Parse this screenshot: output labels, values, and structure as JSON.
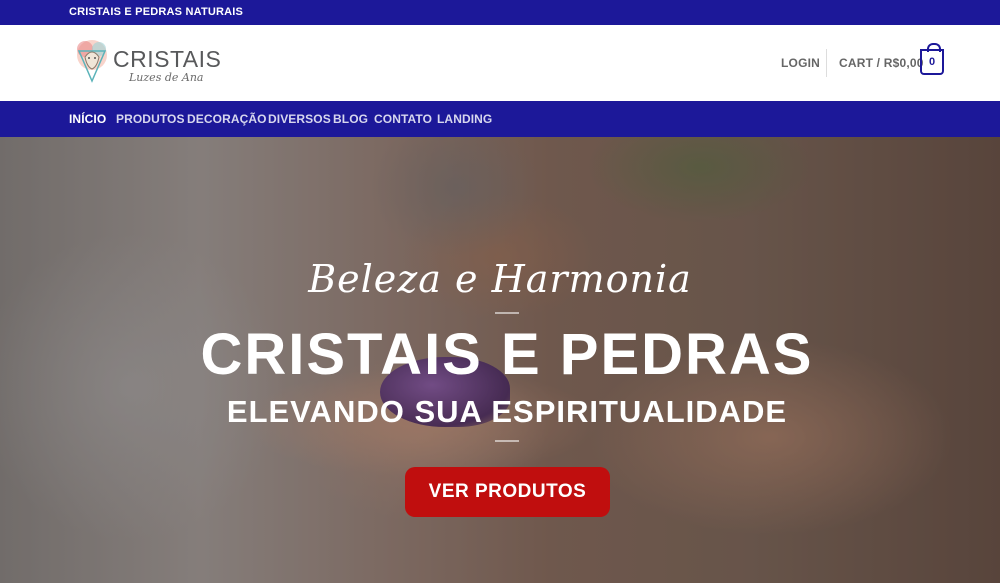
{
  "topbar": {
    "text": "CRISTAIS E PEDRAS NATURAIS"
  },
  "header": {
    "logo": {
      "word": "CRISTAIS",
      "script": "Luzes de Ana"
    },
    "login_label": "LOGIN",
    "cart_label": "CART / R$0,00",
    "cart_count": "0"
  },
  "nav": {
    "items": [
      {
        "label": "INÍCIO",
        "active": true
      },
      {
        "label": "PRODUTOS"
      },
      {
        "label": "DECORAÇÃO"
      },
      {
        "label": "DIVERSOS"
      },
      {
        "label": "BLOG"
      },
      {
        "label": "CONTATO"
      },
      {
        "label": "LANDING"
      }
    ]
  },
  "hero": {
    "script": "Beleza e Harmonia",
    "title": "CRISTAIS E PEDRAS",
    "subtitle": "ELEVANDO SUA ESPIRITUALIDADE",
    "button_label": "VER PRODUTOS"
  },
  "colors": {
    "brand_blue": "#1c1899",
    "cta_red": "#c00e0e"
  },
  "icons": {
    "logo_mark": "crystal-lion-icon",
    "cart": "shopping-bag-icon"
  }
}
